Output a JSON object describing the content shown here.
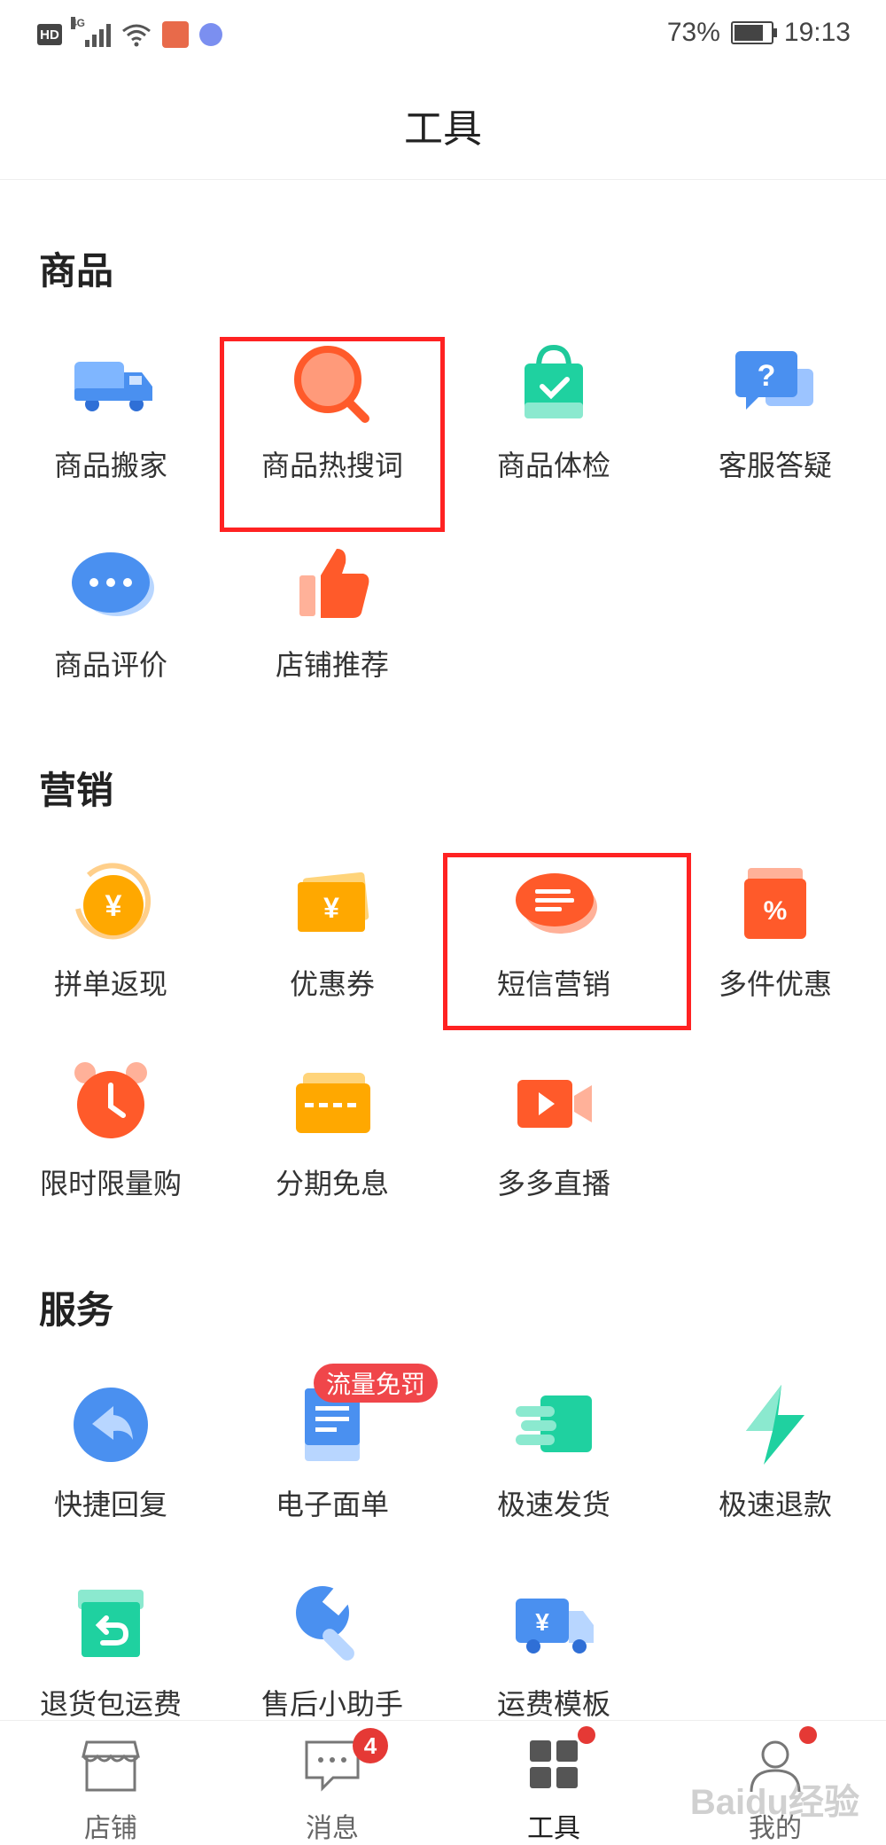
{
  "status": {
    "time": "19:13",
    "battery": "73%",
    "battery_level": 0.73,
    "network": "4G",
    "hd": "HD"
  },
  "header": {
    "title": "工具"
  },
  "sections": [
    {
      "title": "商品",
      "items": [
        "商品搬家",
        "商品热搜词",
        "商品体检",
        "客服答疑",
        "商品评价",
        "店铺推荐"
      ]
    },
    {
      "title": "营销",
      "items": [
        "拼单返现",
        "优惠券",
        "短信营销",
        "多件优惠",
        "限时限量购",
        "分期免息",
        "多多直播"
      ]
    },
    {
      "title": "服务",
      "items": [
        "快捷回复",
        "电子面单",
        "极速发货",
        "极速退款",
        "退货包运费",
        "售后小助手",
        "运费模板"
      ],
      "badge": "流量免罚"
    }
  ],
  "tabs": [
    {
      "label": "店铺"
    },
    {
      "label": "消息",
      "badge": "4"
    },
    {
      "label": "工具",
      "dot": true
    },
    {
      "label": "我的",
      "dot": true
    }
  ],
  "watermark": "Baidu经验",
  "colors": {
    "highlight": "#ff2222",
    "accent": "#f0464a",
    "orange": "#ff6a3d",
    "blue": "#4a90f0",
    "green": "#1fd1a0"
  }
}
